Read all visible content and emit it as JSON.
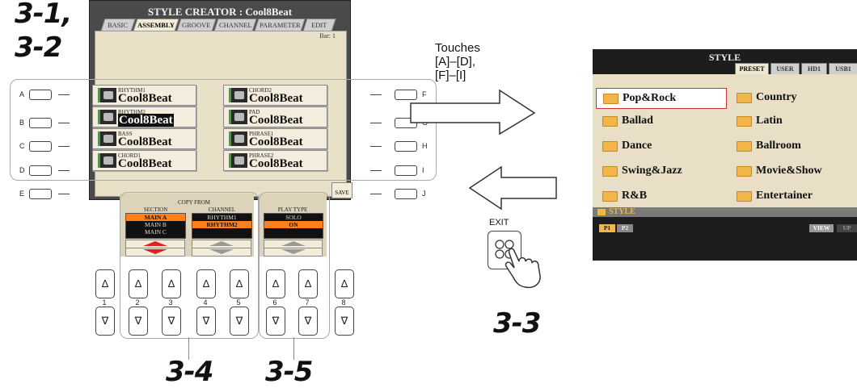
{
  "steps": {
    "s31": "3-1,",
    "s32": "3-2",
    "s33": "3-3",
    "s34": "3-4",
    "s35": "3-5"
  },
  "note": {
    "line1": "Touches",
    "line2": "[A]–[D],",
    "line3": "[F]–[I]"
  },
  "exit_label": "EXIT",
  "lcd": {
    "title": "STYLE CREATOR : Cool8Beat",
    "tabs": [
      "BASIC",
      "ASSEMBLY",
      "GROOVE",
      "CHANNEL",
      "PARAMETER",
      "EDIT"
    ],
    "bar_label": "Bar:  1",
    "cells": [
      {
        "channel": "RHYTHM1",
        "name": "Cool8Beat"
      },
      {
        "channel": "CHORD2",
        "name": "Cool8Beat"
      },
      {
        "channel": "RHYTHM2",
        "name": "Cool8Beat"
      },
      {
        "channel": "PAD",
        "name": "Cool8Beat"
      },
      {
        "channel": "BASS",
        "name": "Cool8Beat"
      },
      {
        "channel": "PHRASE1",
        "name": "Cool8Beat"
      },
      {
        "channel": "CHORD1",
        "name": "Cool8Beat"
      },
      {
        "channel": "PHRASE2",
        "name": "Cool8Beat"
      }
    ],
    "copy_from": "COPY FROM",
    "section_label": "SECTION",
    "sections": [
      "MAIN A",
      "MAIN B",
      "MAIN C"
    ],
    "channel_label": "CHANNEL",
    "channels": [
      "RHYTHM1",
      "RHYTHM2"
    ],
    "play_type_label": "PLAY TYPE",
    "play_types": [
      "SOLO",
      "ON"
    ],
    "save": "SAVE"
  },
  "side_left": [
    "A",
    "B",
    "C",
    "D",
    "E"
  ],
  "side_right": [
    "F",
    "G",
    "H",
    "I",
    "J"
  ],
  "bottom_buttons": [
    "1",
    "2",
    "3",
    "4",
    "5",
    "6",
    "7",
    "8"
  ],
  "lcd2": {
    "title": "STYLE",
    "tabs": [
      "PRESET",
      "USER",
      "HD1",
      "USB1"
    ],
    "folders": [
      "Pop&Rock",
      "Country",
      "Ballad",
      "Latin",
      "Dance",
      "Ballroom",
      "Swing&Jazz",
      "Movie&Show",
      "R&B",
      "Entertainer"
    ],
    "path": "STYLE",
    "page1": "P1",
    "page2": "P2",
    "view": "VIEW",
    "up": "UP"
  }
}
